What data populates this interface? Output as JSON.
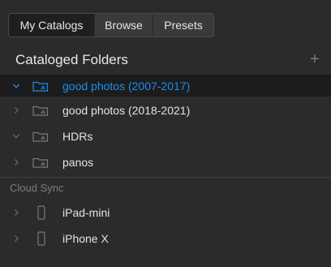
{
  "tabs": [
    {
      "label": "My Catalogs",
      "active": true
    },
    {
      "label": "Browse",
      "active": false
    },
    {
      "label": "Presets",
      "active": false
    }
  ],
  "cataloged_folders": {
    "title": "Cataloged Folders",
    "add_symbol": "+",
    "items": [
      {
        "label": "good photos (2007-2017)",
        "expanded": true,
        "selected": true,
        "icon": "folder-icon"
      },
      {
        "label": "good photos (2018-2021)",
        "expanded": false,
        "selected": false,
        "icon": "folder-icon"
      },
      {
        "label": "HDRs",
        "expanded": true,
        "selected": false,
        "icon": "folder-icon"
      },
      {
        "label": "panos",
        "expanded": false,
        "selected": false,
        "icon": "folder-icon"
      }
    ]
  },
  "cloud_sync": {
    "title": "Cloud Sync",
    "devices": [
      {
        "label": "iPad-mini",
        "icon": "tablet-icon"
      },
      {
        "label": "iPhone X",
        "icon": "phone-icon"
      }
    ]
  },
  "colors": {
    "background": "#2b2b2b",
    "selected_row": "#1c1c1c",
    "accent": "#1d8ef0",
    "muted": "#7d7d7d"
  }
}
